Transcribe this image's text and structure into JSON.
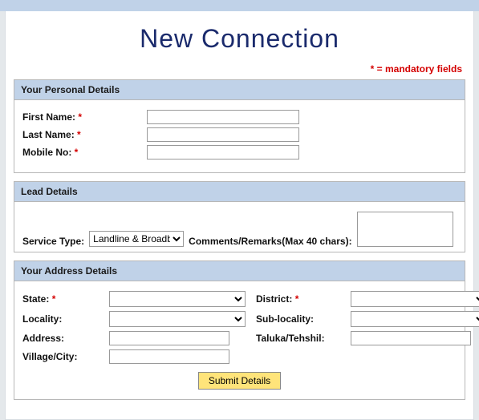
{
  "page": {
    "title": "New Connection",
    "mandatory_note": "* = mandatory fields"
  },
  "sections": {
    "personal": {
      "header": "Your Personal Details",
      "first_name_label": "First Name:",
      "first_name_value": "",
      "last_name_label": "Last Name:",
      "last_name_value": "",
      "mobile_label": "Mobile No:",
      "mobile_value": ""
    },
    "lead": {
      "header": "Lead Details",
      "service_type_label": "Service Type:",
      "service_type_value": "Landline & Broadba",
      "comments_label": "Comments/Remarks(Max 40 chars):",
      "comments_value": ""
    },
    "address": {
      "header": "Your Address Details",
      "state_label": "State:",
      "state_value": "",
      "district_label": "District:",
      "district_value": "",
      "locality_label": "Locality:",
      "locality_value": "",
      "sublocality_label": "Sub-locality:",
      "sublocality_value": "",
      "address_label": "Address:",
      "address_value": "",
      "taluka_label": "Taluka/Tehshil:",
      "taluka_value": "",
      "village_label": "Village/City:",
      "village_value": ""
    }
  },
  "req": "*",
  "submit_label": "Submit Details"
}
